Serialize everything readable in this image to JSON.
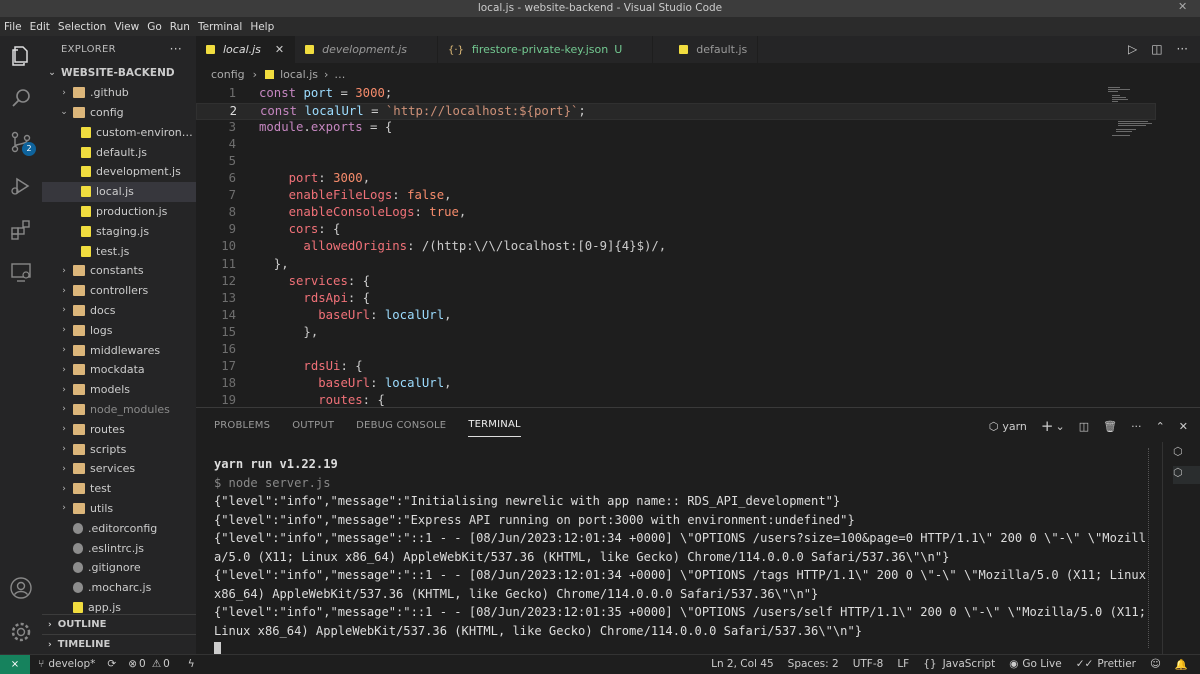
{
  "window": {
    "title": "local.js - website-backend - Visual Studio Code"
  },
  "menu": [
    "File",
    "Edit",
    "Selection",
    "View",
    "Go",
    "Run",
    "Terminal",
    "Help"
  ],
  "activity": {
    "scm_badge": "2"
  },
  "explorer": {
    "header": "EXPLORER",
    "project": "WEBSITE-BACKEND",
    "items": [
      {
        "label": ".github",
        "type": "folder",
        "depth": 1
      },
      {
        "label": "config",
        "type": "folder-open",
        "depth": 1
      },
      {
        "label": "custom-environ…",
        "type": "js",
        "depth": 2
      },
      {
        "label": "default.js",
        "type": "js",
        "depth": 2
      },
      {
        "label": "development.js",
        "type": "js",
        "depth": 2
      },
      {
        "label": "local.js",
        "type": "js",
        "depth": 2,
        "selected": true
      },
      {
        "label": "production.js",
        "type": "js",
        "depth": 2
      },
      {
        "label": "staging.js",
        "type": "js",
        "depth": 2
      },
      {
        "label": "test.js",
        "type": "js",
        "depth": 2
      },
      {
        "label": "constants",
        "type": "folder",
        "depth": 1
      },
      {
        "label": "controllers",
        "type": "folder",
        "depth": 1
      },
      {
        "label": "docs",
        "type": "folder",
        "depth": 1
      },
      {
        "label": "logs",
        "type": "folder",
        "depth": 1
      },
      {
        "label": "middlewares",
        "type": "folder",
        "depth": 1
      },
      {
        "label": "mockdata",
        "type": "folder",
        "depth": 1
      },
      {
        "label": "models",
        "type": "folder",
        "depth": 1
      },
      {
        "label": "node_modules",
        "type": "folder",
        "depth": 1
      },
      {
        "label": "routes",
        "type": "folder",
        "depth": 1
      },
      {
        "label": "scripts",
        "type": "folder",
        "depth": 1
      },
      {
        "label": "services",
        "type": "folder",
        "depth": 1
      },
      {
        "label": "test",
        "type": "folder",
        "depth": 1
      },
      {
        "label": "utils",
        "type": "folder",
        "depth": 1
      },
      {
        "label": ".editorconfig",
        "type": "file",
        "depth": 1
      },
      {
        "label": ".eslintrc.js",
        "type": "file",
        "depth": 1
      },
      {
        "label": ".gitignore",
        "type": "file",
        "depth": 1
      },
      {
        "label": ".mocharc.js",
        "type": "file",
        "depth": 1
      },
      {
        "label": "app.js",
        "type": "js",
        "depth": 1
      }
    ],
    "outline": "OUTLINE",
    "timeline": "TIMELINE"
  },
  "tabs": [
    {
      "label": "local.js",
      "active": true
    },
    {
      "label": "development.js"
    },
    {
      "label": "firestore-private-key.json",
      "status": "U"
    },
    {
      "label": "default.js"
    }
  ],
  "breadcrumb": {
    "folder": "config",
    "file": "local.js",
    "more": "…"
  },
  "code_lines": [
    "const port = 3000;",
    "const localUrl = `http://localhost:${port}`;",
    "module.exports = {",
    "",
    "",
    "    port: 3000,",
    "    enableFileLogs: false,",
    "    enableConsoleLogs: true,",
    "    cors: {",
    "      allowedOrigins: /(http:\\/\\/localhost:[0-9]{4}$)/,",
    "  },",
    "    services: {",
    "      rdsApi: {",
    "        baseUrl: localUrl,",
    "      },",
    "",
    "      rdsUi: {",
    "        baseUrl: localUrl,",
    "        routes: {"
  ],
  "panel": {
    "tabs": [
      "PROBLEMS",
      "OUTPUT",
      "DEBUG CONSOLE",
      "TERMINAL"
    ],
    "terminal_name": "yarn",
    "lines": [
      "yarn run v1.22.19",
      "$ node server.js",
      "{\"level\":\"info\",\"message\":\"Initialising newrelic with app name:: RDS_API_development\"}",
      "{\"level\":\"info\",\"message\":\"Express API running on port:3000 with environment:undefined\"}",
      "{\"level\":\"info\",\"message\":\"::1 - - [08/Jun/2023:12:01:34 +0000] \\\"OPTIONS /users?size=100&page=0 HTTP/1.1\\\" 200 0 \\\"-\\\" \\\"Mozilla/5.0 (X11; Linux x86_64) AppleWebKit/537.36 (KHTML, like Gecko) Chrome/114.0.0.0 Safari/537.36\\\"\\n\"}",
      "{\"level\":\"info\",\"message\":\"::1 - - [08/Jun/2023:12:01:34 +0000] \\\"OPTIONS /tags HTTP/1.1\\\" 200 0 \\\"-\\\" \\\"Mozilla/5.0 (X11; Linux x86_64) AppleWebKit/537.36 (KHTML, like Gecko) Chrome/114.0.0.0 Safari/537.36\\\"\\n\"}",
      "{\"level\":\"info\",\"message\":\"::1 - - [08/Jun/2023:12:01:35 +0000] \\\"OPTIONS /users/self HTTP/1.1\\\" 200 0 \\\"-\\\" \\\"Mozilla/5.0 (X11; Linux x86_64) AppleWebKit/537.36 (KHTML, like Gecko) Chrome/114.0.0.0 Safari/537.36\\\"\\n\"}"
    ]
  },
  "status": {
    "branch": "develop*",
    "errors": "0",
    "warnings": "0",
    "position": "Ln 2, Col 45",
    "spaces": "Spaces: 2",
    "encoding": "UTF-8",
    "eol": "LF",
    "language": "JavaScript",
    "golive": "Go Live",
    "prettier": "Prettier"
  },
  "colors": {
    "accent": "#0e639c",
    "remote": "#16825d",
    "js_icon": "#f1dd3f"
  }
}
